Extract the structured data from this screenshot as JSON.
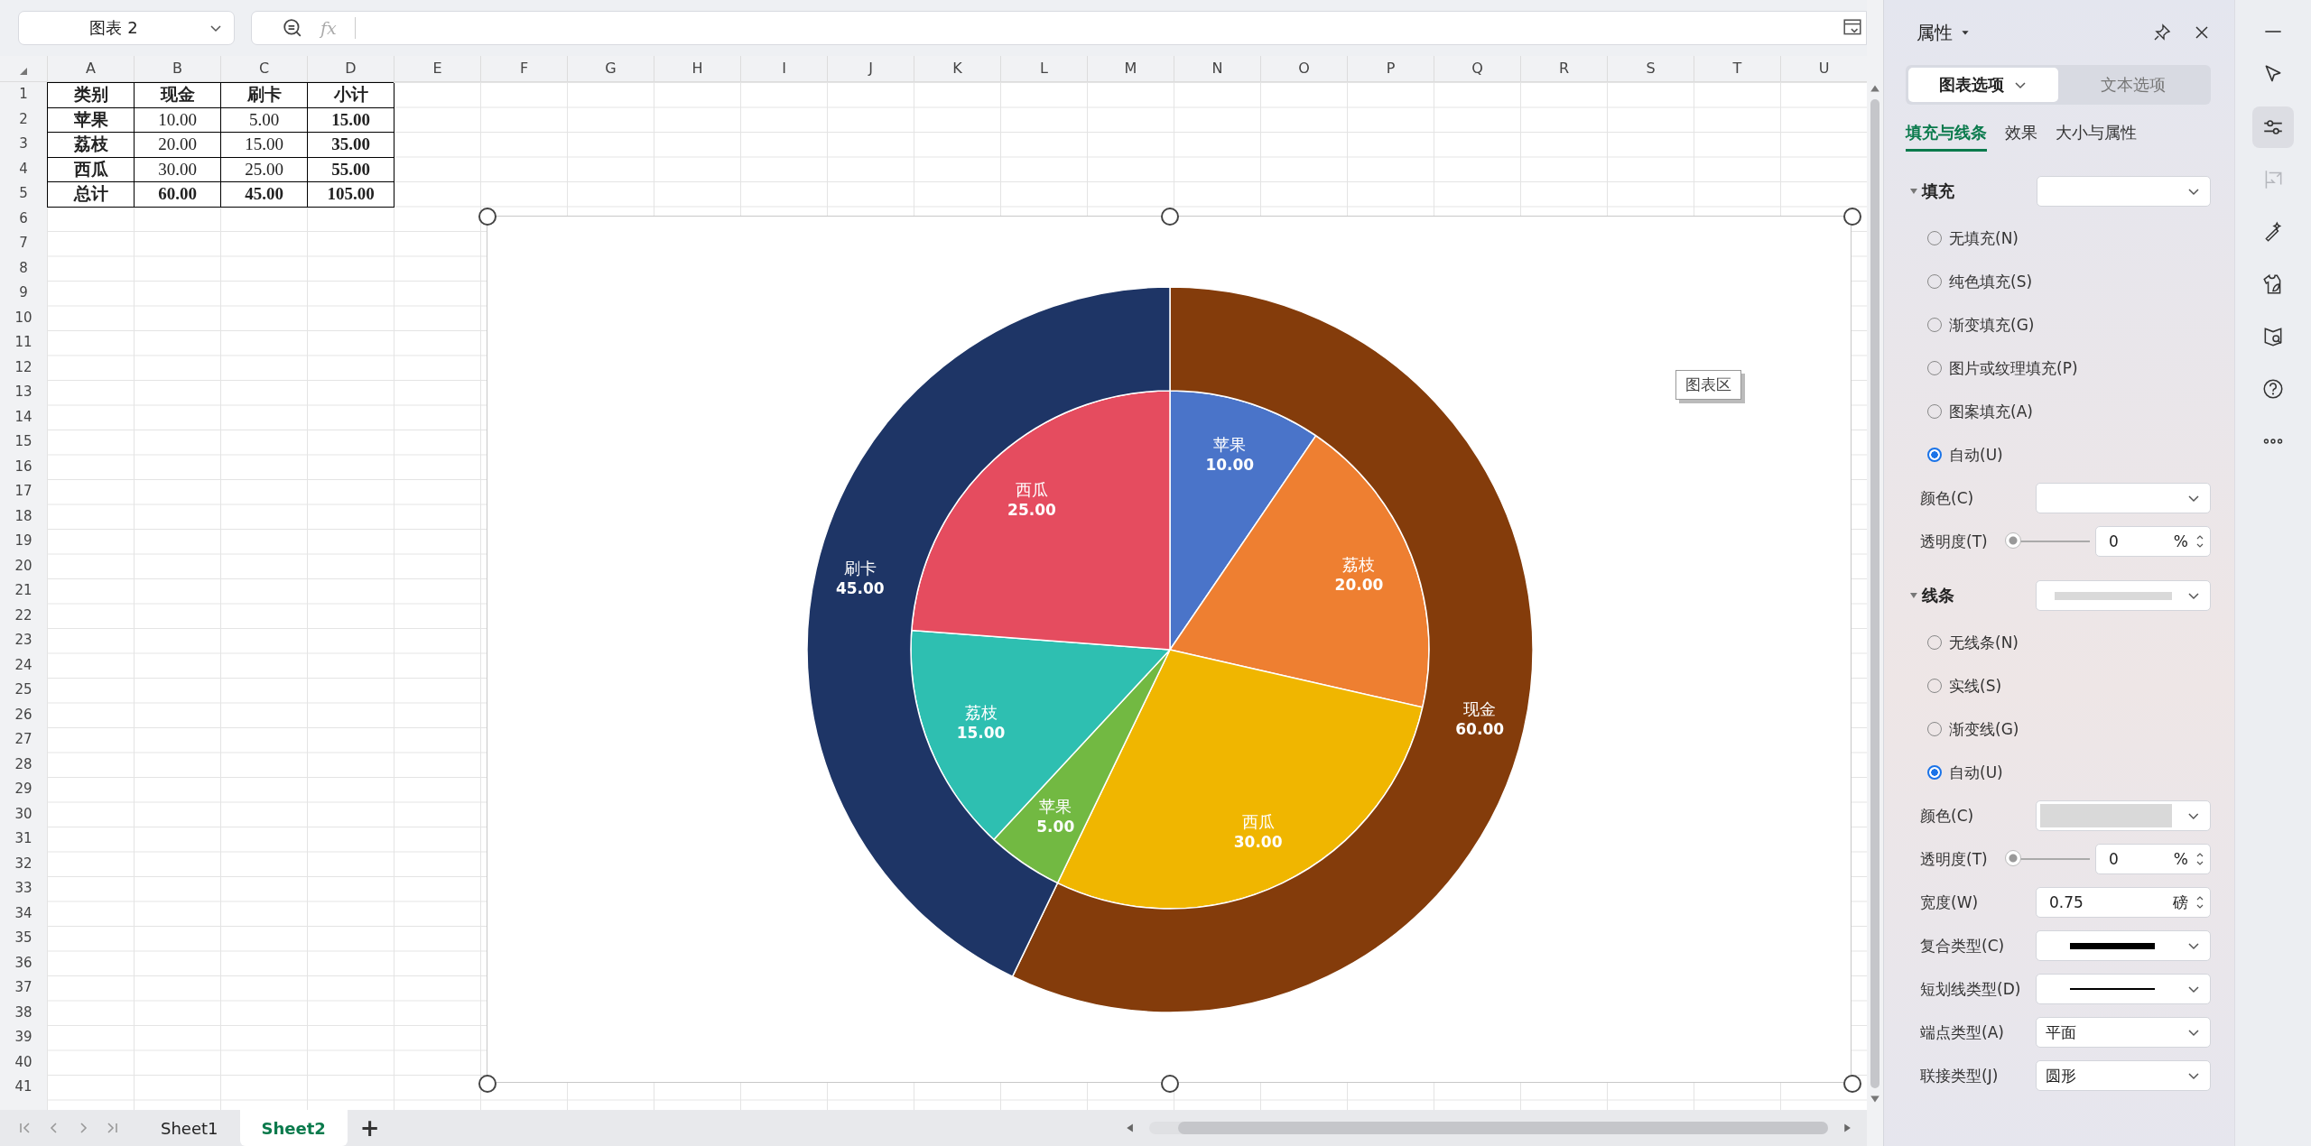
{
  "name_box": {
    "value": "图表 2"
  },
  "formula_bar": {
    "fx_label": "fx"
  },
  "columns": [
    "A",
    "B",
    "C",
    "D",
    "E",
    "F",
    "G",
    "H",
    "I",
    "J",
    "K",
    "L",
    "M",
    "N",
    "O",
    "P",
    "Q",
    "R",
    "S",
    "T",
    "U"
  ],
  "rows": [
    "1",
    "2",
    "3",
    "4",
    "5",
    "6",
    "7",
    "8",
    "9",
    "10",
    "11",
    "12",
    "13",
    "14",
    "15",
    "16",
    "17",
    "18",
    "19",
    "20",
    "21",
    "22",
    "23",
    "24",
    "25",
    "26",
    "27",
    "28",
    "29",
    "30",
    "31",
    "32",
    "33",
    "34",
    "35",
    "36",
    "37",
    "38",
    "39",
    "40",
    "41"
  ],
  "table": [
    [
      {
        "text": "类别",
        "bold": true
      },
      {
        "text": "现金",
        "bold": true
      },
      {
        "text": "刷卡",
        "bold": true
      },
      {
        "text": "小计",
        "bold": true
      }
    ],
    [
      {
        "text": "苹果",
        "bold": true
      },
      {
        "text": "10.00",
        "bold": false
      },
      {
        "text": "5.00",
        "bold": false
      },
      {
        "text": "15.00",
        "bold": true
      }
    ],
    [
      {
        "text": "荔枝",
        "bold": true
      },
      {
        "text": "20.00",
        "bold": false
      },
      {
        "text": "15.00",
        "bold": false
      },
      {
        "text": "35.00",
        "bold": true
      }
    ],
    [
      {
        "text": "西瓜",
        "bold": true
      },
      {
        "text": "30.00",
        "bold": false
      },
      {
        "text": "25.00",
        "bold": false
      },
      {
        "text": "55.00",
        "bold": true
      }
    ],
    [
      {
        "text": "总计",
        "bold": true
      },
      {
        "text": "60.00",
        "bold": true
      },
      {
        "text": "45.00",
        "bold": true
      },
      {
        "text": "105.00",
        "bold": true
      }
    ]
  ],
  "chart": {
    "tooltip": "图表区",
    "inner": {
      "chart_data": {
        "type": "pie",
        "categories": [
          "苹果",
          "荔枝",
          "西瓜",
          "苹果",
          "荔枝",
          "西瓜"
        ],
        "series": [
          {
            "colors": [
              "#4a74c9",
              "#ee7f31",
              "#f0b600",
              "#72b942",
              "#2ebfb1",
              "#e54c5f"
            ],
            "values": [
              10,
              20,
              30,
              5,
              15,
              25
            ],
            "value_labels": [
              "10.00",
              "20.00",
              "30.00",
              "5.00",
              "15.00",
              "25.00"
            ]
          }
        ]
      }
    },
    "outer": {
      "chart_data": {
        "type": "donut",
        "categories": [
          "现金",
          "刷卡"
        ],
        "series": [
          {
            "colors": [
              "#843c0b",
              "#1e3566"
            ],
            "values": [
              60,
              45
            ],
            "value_labels": [
              "60.00",
              "45.00"
            ]
          }
        ]
      }
    }
  },
  "sheet_tabs": [
    {
      "label": "Sheet1",
      "selected": false
    },
    {
      "label": "Sheet2",
      "selected": true
    }
  ],
  "add_sheet": "+",
  "panel": {
    "title": "属性",
    "option_tabs": [
      {
        "label": "图表选项",
        "selected": true
      },
      {
        "label": "文本选项",
        "selected": false
      }
    ],
    "sub_tabs": [
      {
        "label": "填充与线条",
        "selected": true
      },
      {
        "label": "效果",
        "selected": false
      },
      {
        "label": "大小与属性",
        "selected": false
      }
    ],
    "sections": [
      {
        "title": "填充",
        "expanded": true,
        "radios": [
          {
            "label": "无填充(N)",
            "selected": false
          },
          {
            "label": "纯色填充(S)",
            "selected": false
          },
          {
            "label": "渐变填充(G)",
            "selected": false
          },
          {
            "label": "图片或纹理填充(P)",
            "selected": false
          },
          {
            "label": "图案填充(A)",
            "selected": false
          },
          {
            "label": "自动(U)",
            "selected": true
          }
        ],
        "fields": [
          {
            "kind": "color",
            "label": "颜色(C)"
          },
          {
            "kind": "slider",
            "label": "透明度(T)",
            "level": 0,
            "value": "0",
            "unit": "%"
          }
        ]
      },
      {
        "title": "线条",
        "expanded": true,
        "color": "#d9d9d9",
        "radios": [
          {
            "label": "无线条(N)",
            "selected": false
          },
          {
            "label": "实线(S)",
            "selected": false
          },
          {
            "label": "渐变线(G)",
            "selected": false
          },
          {
            "label": "自动(U)",
            "selected": true
          }
        ],
        "fields": [
          {
            "kind": "color",
            "label": "颜色(C)",
            "color": "#d9d9d9"
          },
          {
            "kind": "slider",
            "label": "透明度(T)",
            "level": 0,
            "value": "0",
            "unit": "%"
          },
          {
            "kind": "spin",
            "label": "宽度(W)",
            "value": "0.75",
            "unit": "磅"
          },
          {
            "kind": "compound",
            "label": "复合类型(C)"
          },
          {
            "kind": "dash",
            "label": "短划线类型(D)"
          },
          {
            "kind": "select",
            "label": "端点类型(A)",
            "value": "平面"
          },
          {
            "kind": "select",
            "label": "联接类型(J)",
            "value": "圆形"
          }
        ]
      }
    ]
  },
  "side_tools": [
    {
      "kind": "select",
      "selected": false,
      "disabled": false
    },
    {
      "kind": "properties",
      "selected": true,
      "disabled": false
    },
    {
      "kind": "crop",
      "selected": false,
      "disabled": true
    },
    {
      "kind": "wand",
      "selected": false,
      "disabled": false
    },
    {
      "kind": "style",
      "selected": false,
      "disabled": false
    },
    {
      "kind": "find",
      "selected": false,
      "disabled": false
    },
    {
      "kind": "help",
      "selected": false,
      "disabled": false
    },
    {
      "kind": "more",
      "selected": false,
      "disabled": false
    }
  ]
}
